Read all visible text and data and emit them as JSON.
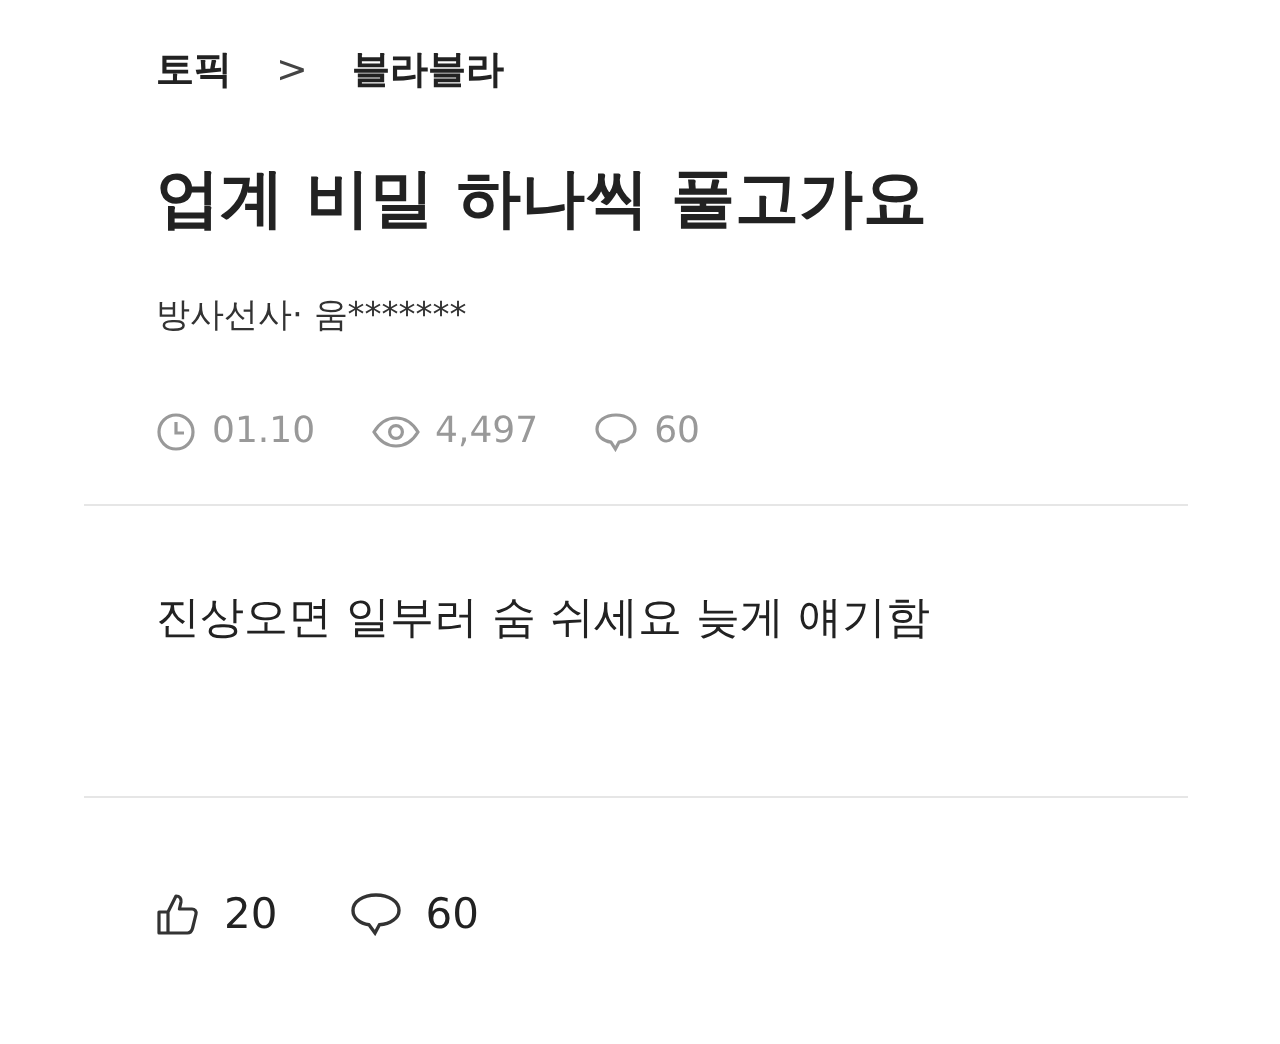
{
  "breadcrumb": {
    "section": "토픽",
    "separator": ">",
    "topic": "블라블라"
  },
  "title": "업계 비밀 하나씩 풀고가요",
  "author": "방사선사· 움*******",
  "stats": {
    "date": "01.10",
    "views": "4,497",
    "comments": "60"
  },
  "body": "진상오면 일부러 숨 쉬세요 늦게 얘기함",
  "footer": {
    "likes": "20",
    "comments": "60"
  }
}
